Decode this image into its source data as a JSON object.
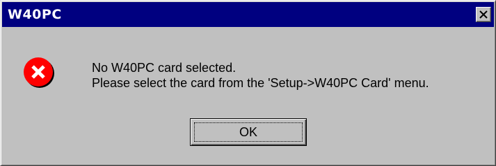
{
  "window": {
    "title": "W40PC",
    "titlebar_color": "#000080",
    "face_color": "#c0c0c0"
  },
  "icon": {
    "name": "error-icon",
    "color": "#ff0000"
  },
  "message": {
    "line1": "No W40PC card selected.",
    "line2": "Please select the card from the 'Setup->W40PC Card' menu."
  },
  "buttons": {
    "ok_label": "OK"
  }
}
